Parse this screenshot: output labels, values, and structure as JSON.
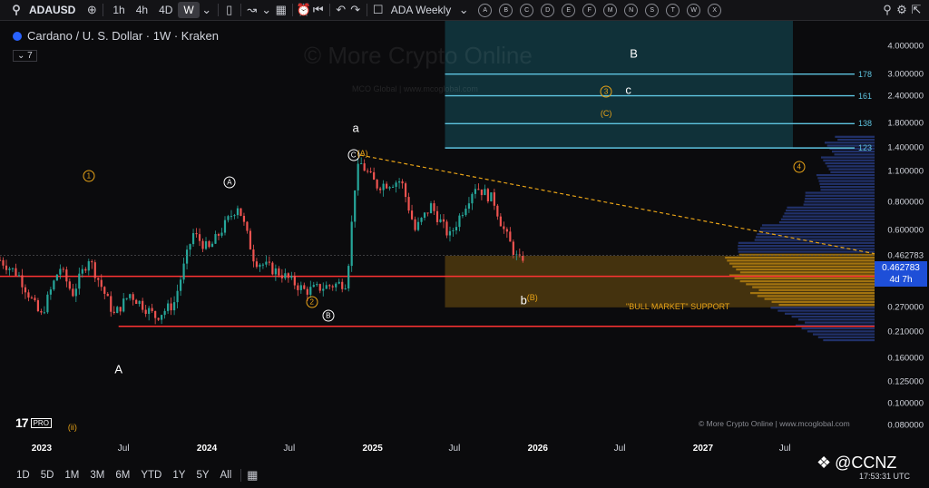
{
  "toolbar": {
    "symbol": "ADAUSD",
    "intervals": [
      "1h",
      "4h",
      "4D",
      "W"
    ],
    "active_interval": "W",
    "layout_name": "ADA Weekly",
    "letters": [
      "A",
      "B",
      "C",
      "D",
      "E",
      "F",
      "M",
      "N",
      "S",
      "T",
      "W",
      "X"
    ]
  },
  "legend": {
    "title": "Cardano / U. S. Dollar · 1W · Kraken",
    "indicator_count": "7"
  },
  "watermark": {
    "main": "© More Crypto Online",
    "sub": "MCO Global   |   www.mcoglobal.com"
  },
  "branding": {
    "tv": "17",
    "pro": "PRO",
    "credit": "© More Crypto Online  |  www.mcoglobal.com",
    "ccnz": "@CCNZ",
    "clock": "17:53:31 UTC"
  },
  "price_tag": {
    "value": "0.462783",
    "countdown": "4d 7h"
  },
  "bull_label": "\"BULL MARKET\" SUPPORT",
  "range_buttons": [
    "1D",
    "5D",
    "1M",
    "3M",
    "6M",
    "YTD",
    "1Y",
    "5Y",
    "All"
  ],
  "fib_tags": [
    {
      "text": "178",
      "price": 3.0
    },
    {
      "text": "161",
      "price": 2.4
    },
    {
      "text": "138",
      "price": 1.8
    },
    {
      "text": "123",
      "price": 1.4
    }
  ],
  "wave_labels": {
    "white_big": [
      {
        "text": "A",
        "date": "2023-06-20",
        "price": 0.142
      },
      {
        "text": "a",
        "date": "2024-11-25",
        "price": 1.72
      },
      {
        "text": "B",
        "date": "2026-08-01",
        "price": 3.7
      },
      {
        "text": "c",
        "date": "2026-07-20",
        "price": 2.55
      },
      {
        "text": "b",
        "date": "2025-12-01",
        "price": 0.29
      }
    ],
    "white_circled": [
      {
        "text": "A",
        "date": "2024-02-20",
        "price": 0.98
      },
      {
        "text": "B",
        "date": "2024-09-25",
        "price": 0.248
      },
      {
        "text": "C",
        "date": "2024-11-20",
        "price": 1.3
      }
    ],
    "orange_circled": [
      {
        "text": "1",
        "date": "2023-04-15",
        "price": 1.05
      },
      {
        "text": "2",
        "date": "2024-08-20",
        "price": 0.285
      },
      {
        "text": "3",
        "date": "2026-06-01",
        "price": 2.5
      },
      {
        "text": "4",
        "date": "2027-08-01",
        "price": 1.15
      }
    ],
    "orange_text": [
      {
        "text": "(A)",
        "date": "2024-12-10",
        "price": 1.32
      },
      {
        "text": "(C)",
        "date": "2026-06-01",
        "price": 2.0
      },
      {
        "text": "(B)",
        "date": "2025-12-20",
        "price": 0.3
      },
      {
        "text": "(ii)",
        "date": "2023-03-10",
        "price": 0.078
      }
    ]
  },
  "chart_data": {
    "type": "candlestick",
    "title": "Cardano / U. S. Dollar · 1W · Kraken",
    "y_scale": "log",
    "ylim": [
      0.07,
      5.2
    ],
    "xlim": [
      "2022-10-01",
      "2028-01-15"
    ],
    "y_ticks": [
      4.0,
      3.0,
      2.4,
      1.8,
      1.4,
      1.1,
      0.8,
      0.6,
      0.46,
      0.35,
      0.27,
      0.21,
      0.16,
      0.125,
      0.1,
      0.08
    ],
    "y_tick_labels": [
      "4.000000",
      "3.000000",
      "2.400000",
      "1.800000",
      "1.400000",
      "1.100000",
      "0.800000",
      "0.600000",
      "0.462783",
      "0.350000",
      "0.270000",
      "0.210000",
      "0.160000",
      "0.125000",
      "0.100000",
      "0.080000"
    ],
    "x_ticks": [
      {
        "label": "2023",
        "date": "2023-01-01",
        "year": true
      },
      {
        "label": "Jul",
        "date": "2023-07-01",
        "year": false
      },
      {
        "label": "2024",
        "date": "2024-01-01",
        "year": true
      },
      {
        "label": "Jul",
        "date": "2024-07-01",
        "year": false
      },
      {
        "label": "2025",
        "date": "2025-01-01",
        "year": true
      },
      {
        "label": "Jul",
        "date": "2025-07-01",
        "year": false
      },
      {
        "label": "2026",
        "date": "2026-01-01",
        "year": true
      },
      {
        "label": "Jul",
        "date": "2026-07-01",
        "year": false
      },
      {
        "label": "2027",
        "date": "2027-01-01",
        "year": true
      },
      {
        "label": "Jul",
        "date": "2027-07-01",
        "year": false
      }
    ],
    "anchors": [
      {
        "date": "2022-10-01",
        "price": 0.44
      },
      {
        "date": "2022-11-10",
        "price": 0.38
      },
      {
        "date": "2022-12-30",
        "price": 0.245
      },
      {
        "date": "2023-02-10",
        "price": 0.41
      },
      {
        "date": "2023-03-10",
        "price": 0.31
      },
      {
        "date": "2023-04-15",
        "price": 0.45
      },
      {
        "date": "2023-06-10",
        "price": 0.25
      },
      {
        "date": "2023-07-15",
        "price": 0.31
      },
      {
        "date": "2023-09-10",
        "price": 0.245
      },
      {
        "date": "2023-10-20",
        "price": 0.28
      },
      {
        "date": "2023-12-01",
        "price": 0.58
      },
      {
        "date": "2024-01-05",
        "price": 0.49
      },
      {
        "date": "2024-03-10",
        "price": 0.78
      },
      {
        "date": "2024-04-15",
        "price": 0.44
      },
      {
        "date": "2024-06-15",
        "price": 0.38
      },
      {
        "date": "2024-08-05",
        "price": 0.32
      },
      {
        "date": "2024-10-05",
        "price": 0.34
      },
      {
        "date": "2024-11-05",
        "price": 0.35
      },
      {
        "date": "2024-11-25",
        "price": 1.05
      },
      {
        "date": "2024-12-05",
        "price": 1.2
      },
      {
        "date": "2025-01-10",
        "price": 0.95
      },
      {
        "date": "2025-03-05",
        "price": 1.0
      },
      {
        "date": "2025-04-05",
        "price": 0.6
      },
      {
        "date": "2025-05-10",
        "price": 0.77
      },
      {
        "date": "2025-06-20",
        "price": 0.56
      },
      {
        "date": "2025-08-15",
        "price": 0.95
      },
      {
        "date": "2025-09-25",
        "price": 0.82
      },
      {
        "date": "2025-10-15",
        "price": 0.62
      },
      {
        "date": "2025-11-20",
        "price": 0.43
      },
      {
        "date": "2025-12-01",
        "price": 0.46
      }
    ],
    "horizontal_lines": [
      {
        "name": "support-red",
        "price": 0.372,
        "color": "#ff3333"
      },
      {
        "name": "A-low",
        "price": 0.222,
        "color": "#ff3333",
        "from": "2023-06-20"
      },
      {
        "name": "fib-178",
        "price": 3.0,
        "color": "#5ec4e0",
        "from": "2025-06-10"
      },
      {
        "name": "fib-161",
        "price": 2.4,
        "color": "#5ec4e0",
        "from": "2025-06-10"
      },
      {
        "name": "fib-138",
        "price": 1.8,
        "color": "#5ec4e0",
        "from": "2025-06-10"
      },
      {
        "name": "fib-123",
        "price": 1.4,
        "color": "#5ec4e0",
        "from": "2025-06-10"
      }
    ],
    "trendline": {
      "from": {
        "date": "2024-12-05",
        "price": 1.3
      },
      "to": {
        "date": "2028-01-15",
        "price": 0.47
      },
      "color": "#e8a317",
      "dashed": true
    },
    "support_zone": {
      "from": "2025-06-10",
      "price_low": 0.27,
      "price_high": 0.46,
      "color": "#b07a10"
    },
    "fib_zone": {
      "from": "2025-06-10",
      "price_low": 1.4,
      "price_high": 5.2,
      "color": "#123842"
    },
    "colors": {
      "up": "#26a69a",
      "down": "#ef5350",
      "bg": "#0b0b0d",
      "volume_profile": "#2a3f8a"
    }
  }
}
